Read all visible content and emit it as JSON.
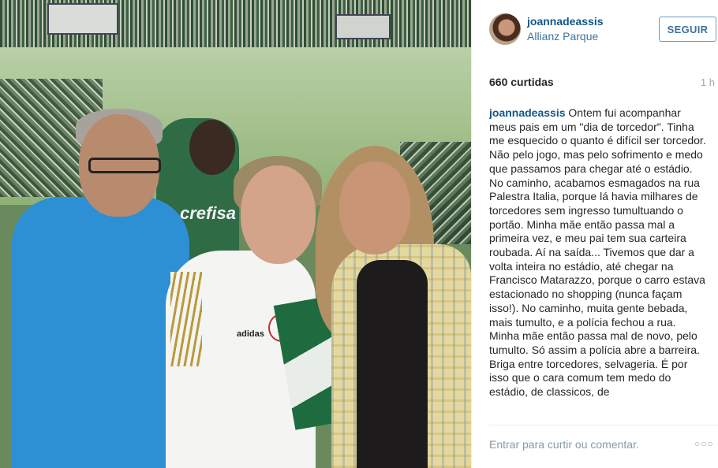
{
  "photo": {
    "shirt_text": "crefisa",
    "crest_letter": "P",
    "brand_text": "adidas"
  },
  "header": {
    "username": "joannadeassis",
    "location": "Allianz Parque",
    "follow_label": "SEGUIR"
  },
  "stats": {
    "likes": "660 curtidas",
    "time": "1 h"
  },
  "caption": {
    "username": "joannadeassis",
    "text": "Ontem fui acompanhar meus pais em um \"dia de torcedor\". Tinha me esquecido o quanto é difícil ser torcedor. Não pelo jogo, mas pelo sofrimento e medo que passamos para chegar até o estádio. No caminho, acabamos esmagados na rua Palestra Italia, porque lá havia milhares de torcedores sem ingresso tumultuando o portão. Minha mãe então passa mal a primeira vez, e meu pai tem sua carteira roubada. Aí na saída... Tivemos que dar a volta inteira no estádio, até chegar na Francisco Matarazzo, porque o carro estava estacionado no shopping (nunca façam isso!). No caminho, muita gente bebada, mais tumulto, e a polícia fechou a rua. Minha mãe então passa mal de novo, pelo tumulto. Só assim a polícia abre a barreira. Briga entre torcedores, selvageria. É por isso que o cara comum tem medo do estádio, de classicos, de"
  },
  "footer": {
    "comment_prompt": "Entrar para curtir ou comentar.",
    "more_icon": "ellipsis-icon",
    "more_glyph": "○○○"
  },
  "colors": {
    "link_blue": "#125688",
    "location_blue": "#3f729b",
    "muted": "#a5a7aa"
  }
}
